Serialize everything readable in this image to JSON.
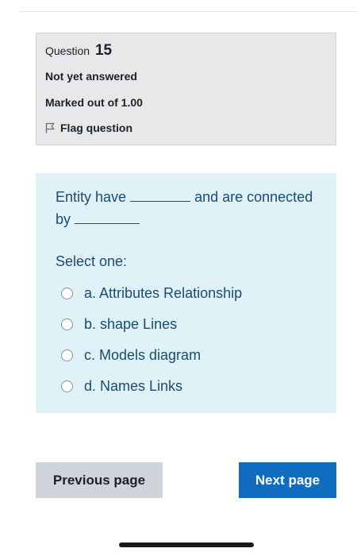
{
  "info": {
    "question_prefix": "Question",
    "question_number": "15",
    "state": "Not yet answered",
    "grade": "Marked out of 1.00",
    "flag_label": "Flag question",
    "flag_icon": "flag-outline-icon"
  },
  "question": {
    "text_part1": "Entity have",
    "text_part2": "and are connected by",
    "prompt": "Select one:",
    "options": [
      {
        "label": "a. Attributes Relationship",
        "selected": false
      },
      {
        "label": "b. shape Lines",
        "selected": false
      },
      {
        "label": "c. Models diagram",
        "selected": false
      },
      {
        "label": "d. Names Links",
        "selected": false
      }
    ]
  },
  "navigation": {
    "previous_label": "Previous page",
    "next_label": "Next page"
  },
  "colors": {
    "info_background": "#e6e8ea",
    "question_background": "#def2f8",
    "question_text": "#1d4a6e",
    "primary_button": "#0f6cbf",
    "secondary_button": "#ced4da"
  }
}
